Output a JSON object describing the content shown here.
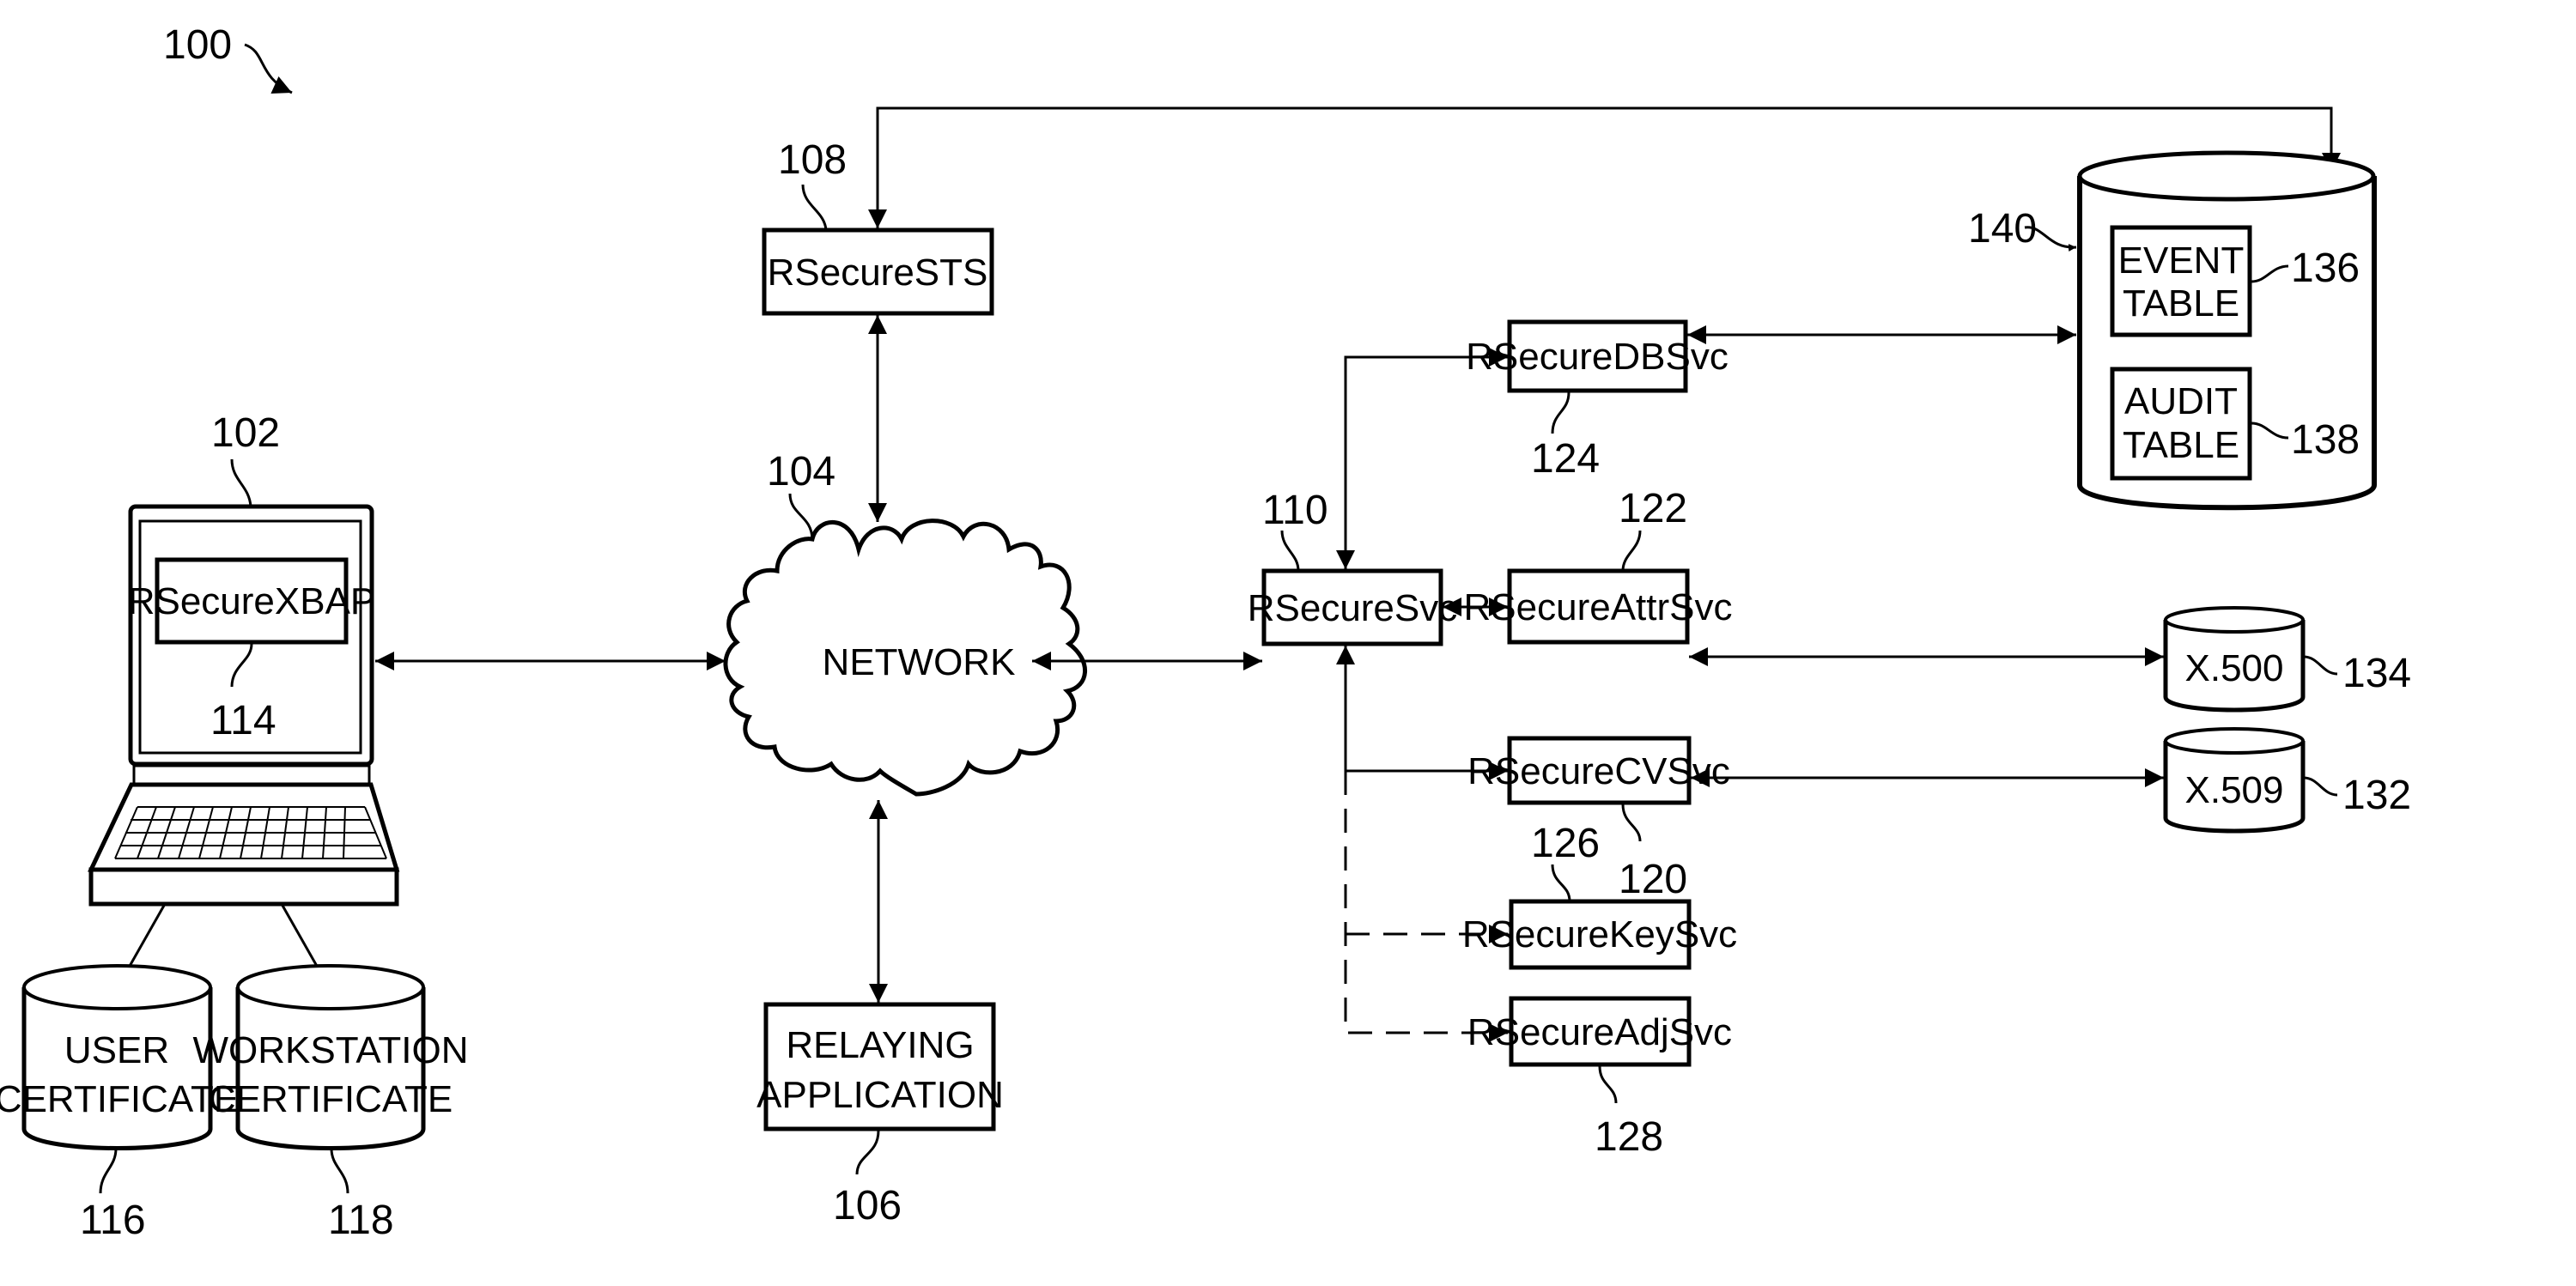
{
  "figure_ref": "100",
  "client": {
    "ref": "102",
    "app_box": {
      "ref": "114",
      "label": "RSecureXBAP"
    }
  },
  "certificates": [
    {
      "ref": "116",
      "lines": [
        "USER",
        "CERTIFICATE"
      ]
    },
    {
      "ref": "118",
      "lines": [
        "WORKSTATION",
        "CERTIFICATE"
      ]
    }
  ],
  "network": {
    "ref": "104",
    "label": "NETWORK"
  },
  "sts": {
    "ref": "108",
    "label": "RSecureSTS"
  },
  "relaying_app": {
    "ref": "106",
    "lines": [
      "RELAYING",
      "APPLICATION"
    ]
  },
  "svc": {
    "ref": "110",
    "label": "RSecureSvc"
  },
  "services": [
    {
      "id": "db",
      "ref": "124",
      "label": "RSecureDBSvc",
      "link": "solid"
    },
    {
      "id": "attr",
      "ref": "122",
      "label": "RSecureAttrSvc",
      "link": "solid"
    },
    {
      "id": "cv",
      "ref": "120",
      "label": "RSecureCVSvc",
      "link": "solid"
    },
    {
      "id": "key",
      "ref": "126",
      "label": "RSecureKeySvc",
      "link": "dashed"
    },
    {
      "id": "adj",
      "ref": "128",
      "label": "RSecureAdjSvc",
      "link": "dashed"
    }
  ],
  "database": {
    "ref": "140",
    "tables": [
      {
        "ref": "136",
        "lines": [
          "EVENT",
          "TABLE"
        ]
      },
      {
        "ref": "138",
        "lines": [
          "AUDIT",
          "TABLE"
        ]
      }
    ]
  },
  "directories": [
    {
      "ref": "134",
      "label": "X.500"
    },
    {
      "ref": "132",
      "label": "X.509"
    }
  ]
}
